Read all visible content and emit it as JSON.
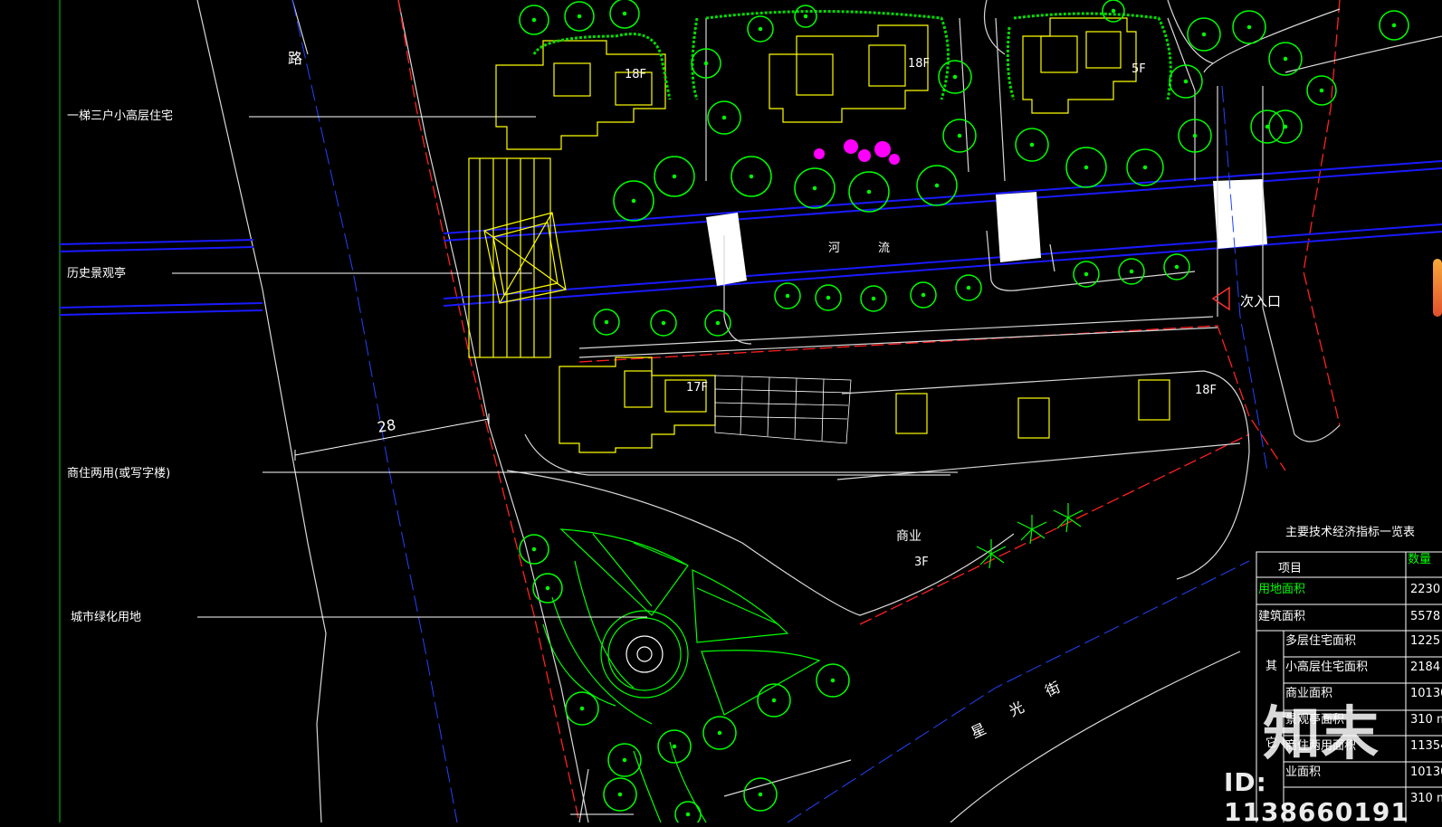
{
  "labels": {
    "residential_highrise": "一梯三户小高层住宅",
    "history_pavilion": "历史景观亭",
    "commercial_residential": "商住两用(或写字楼)",
    "urban_green": "城市绿化用地"
  },
  "road_top": "路",
  "road_bottom": [
    "星",
    "光",
    "街"
  ],
  "river": [
    "河",
    "流"
  ],
  "secondary_entrance": "次入口",
  "dimension": "28",
  "floors": [
    "18F",
    "18F",
    "5F",
    "17F",
    "18F"
  ],
  "commercial": {
    "name": "商业",
    "floors": "3F"
  },
  "table": {
    "title": "主要技术经济指标一览表",
    "col_item": "项目",
    "col_qty": "数量",
    "rows": [
      {
        "label": "用地面积",
        "value": "2230"
      },
      {
        "label": "建筑面积",
        "value": "5578"
      },
      {
        "label": "多层住宅面积",
        "value": "1225"
      },
      {
        "label": "小高层住宅面积",
        "value": "2184"
      },
      {
        "label": "商业面积",
        "value": "10130"
      },
      {
        "label": "景观亭面积",
        "value": "310 m"
      },
      {
        "label": "商住两用面积",
        "value": "11354"
      },
      {
        "label": "业面积",
        "value": "10130"
      },
      {
        "label": "",
        "value": "310 m"
      }
    ],
    "side_chars": [
      "其",
      "它"
    ]
  },
  "watermark": {
    "logo": "知末",
    "id": "ID: 1138660191"
  },
  "colors": {
    "background": "#000000",
    "buildings": "#ffff00",
    "trees": "#00ff00",
    "river": "#1a1aff",
    "boundary": "#ff0000",
    "flowers": "#ff00ff"
  }
}
